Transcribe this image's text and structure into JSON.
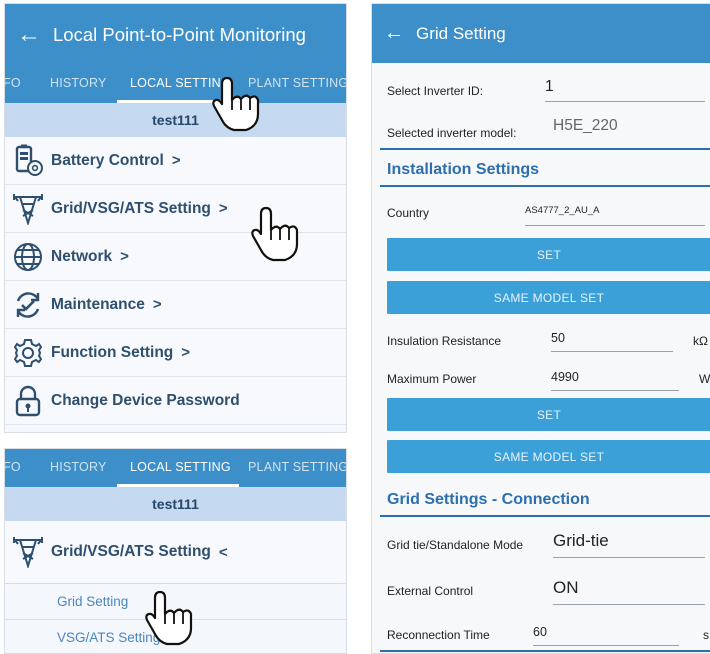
{
  "panel1": {
    "back_glyph": "←",
    "title": "Local Point-to-Point Monitoring",
    "tabs": [
      "FO",
      "HISTORY",
      "LOCAL SETTING",
      "PLANT SETTING"
    ],
    "device": "test111",
    "menu": [
      {
        "label": "Battery Control",
        "chevron": ">",
        "icon": "battery-settings-icon"
      },
      {
        "label": "Grid/VSG/ATS Setting",
        "chevron": ">",
        "icon": "power-tower-icon"
      },
      {
        "label": "Network",
        "chevron": ">",
        "icon": "globe-icon"
      },
      {
        "label": "Maintenance",
        "chevron": ">",
        "icon": "refresh-check-icon"
      },
      {
        "label": "Function Setting",
        "chevron": ">",
        "icon": "gear-icon"
      },
      {
        "label": "Change Device Password",
        "chevron": "",
        "icon": "lock-icon"
      }
    ]
  },
  "panel2": {
    "tabs": [
      "FO",
      "HISTORY",
      "LOCAL SETTING",
      "PLANT SETTING"
    ],
    "device": "test111",
    "group": {
      "label": "Grid/VSG/ATS Setting",
      "chevron": "<"
    },
    "sub_items": [
      "Grid Setting",
      "VSG/ATS Setting"
    ]
  },
  "panel3": {
    "back_glyph": "←",
    "title": "Grid Setting",
    "select_inverter_label": "Select Inverter ID:",
    "select_inverter_value": "1",
    "selected_model_label": "Selected inverter model:",
    "selected_model_value": "H5E_220",
    "installation_header": "Installation Settings",
    "country_label": "Country",
    "country_value": "AS4777_2_AU_A",
    "set_label": "SET",
    "same_model_set_label": "SAME MODEL SET",
    "insulation_label": "Insulation Resistance",
    "insulation_value": "50",
    "insulation_unit": "kΩ",
    "max_power_label": "Maximum Power",
    "max_power_value": "4990",
    "max_power_unit": "W",
    "connection_header": "Grid Settings - Connection",
    "mode_label": "Grid tie/Standalone Mode",
    "mode_value": "Grid-tie",
    "external_label": "External Control",
    "external_value": "ON",
    "reconnection_label": "Reconnection Time",
    "reconnection_value": "60",
    "reconnection_unit": "s"
  },
  "colors": {
    "primary": "#3d8fc9",
    "button": "#3ba0d8",
    "section": "#2d6fae",
    "device_bar": "#c5daf0"
  }
}
